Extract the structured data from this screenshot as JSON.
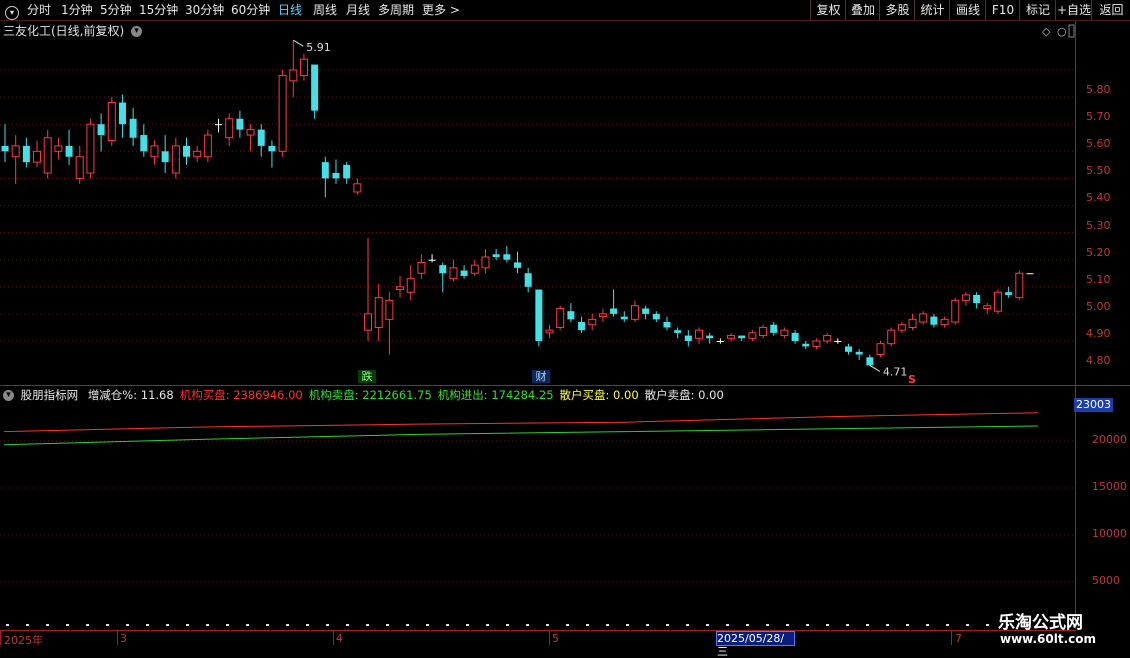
{
  "toolbar": {
    "periods": [
      "分时",
      "1分钟",
      "5分钟",
      "15分钟",
      "30分钟",
      "60分钟",
      "日线",
      "周线",
      "月线",
      "多周期",
      "更多 >"
    ],
    "active_period": "日线",
    "right_buttons": [
      "复权",
      "叠加",
      "多股",
      "统计",
      "画线",
      "F10",
      "标记",
      "+自选",
      "返回"
    ]
  },
  "stock": {
    "title": "三友化工(日线,前复权)"
  },
  "price_axis": [
    "5.80",
    "5.70",
    "5.60",
    "5.50",
    "5.40",
    "5.30",
    "5.20",
    "5.10",
    "5.00",
    "4.90",
    "4.80"
  ],
  "markers": {
    "high": "5.91",
    "low": "4.71",
    "event_a": "跌",
    "event_b": "财",
    "signal": "S"
  },
  "indicator": {
    "name": "股朋指标网",
    "items": [
      {
        "label": "增减仓%: 11.68",
        "color": "#e8e8e8"
      },
      {
        "label": "机构买盘: 2386946.00",
        "color": "#ff3030"
      },
      {
        "label": "机构卖盘: 2212661.75",
        "color": "#30e030"
      },
      {
        "label": "机构进出: 174284.25",
        "color": "#30e030"
      },
      {
        "label": "散户买盘: 0.00",
        "color": "#ffff40"
      },
      {
        "label": "散户卖盘: 0.00",
        "color": "#e8e8e8"
      }
    ],
    "current_value": "23003",
    "axis": [
      "20000",
      "15000",
      "10000",
      "5000"
    ]
  },
  "dates": {
    "year": "2025年",
    "months": [
      "3",
      "4",
      "5",
      "7"
    ],
    "selected": "2025/05/28/三"
  },
  "watermark": {
    "line1": "乐淘公式网",
    "line2": "www.60lt.com"
  },
  "colors": {
    "up": "#ff3b3b",
    "down": "#44e0e8",
    "flat": "#ffffff",
    "buy_line": "#ff3030",
    "sell_line": "#30d030",
    "axis": "#a02020"
  },
  "chart_data": {
    "type": "candlestick",
    "title": "三友化工(日线,前复权)",
    "ylim": [
      4.71,
      5.91
    ],
    "candles": [
      [
        5.52,
        5.5,
        5.6,
        5.46
      ],
      [
        5.48,
        5.52,
        5.56,
        5.38
      ],
      [
        5.52,
        5.46,
        5.55,
        5.44
      ],
      [
        5.46,
        5.5,
        5.54,
        5.44
      ],
      [
        5.42,
        5.55,
        5.58,
        5.4
      ],
      [
        5.5,
        5.52,
        5.55,
        5.47
      ],
      [
        5.52,
        5.48,
        5.58,
        5.45
      ],
      [
        5.4,
        5.48,
        5.52,
        5.38
      ],
      [
        5.42,
        5.6,
        5.62,
        5.4
      ],
      [
        5.6,
        5.56,
        5.64,
        5.5
      ],
      [
        5.54,
        5.68,
        5.7,
        5.52
      ],
      [
        5.68,
        5.6,
        5.71,
        5.55
      ],
      [
        5.62,
        5.55,
        5.66,
        5.52
      ],
      [
        5.56,
        5.5,
        5.6,
        5.48
      ],
      [
        5.48,
        5.52,
        5.54,
        5.45
      ],
      [
        5.5,
        5.46,
        5.56,
        5.42
      ],
      [
        5.42,
        5.52,
        5.55,
        5.4
      ],
      [
        5.52,
        5.48,
        5.55,
        5.45
      ],
      [
        5.48,
        5.5,
        5.52,
        5.46
      ],
      [
        5.48,
        5.56,
        5.58,
        5.46
      ],
      [
        5.6,
        5.6,
        5.62,
        5.57
      ],
      [
        5.55,
        5.62,
        5.64,
        5.52
      ],
      [
        5.62,
        5.58,
        5.65,
        5.55
      ],
      [
        5.56,
        5.58,
        5.6,
        5.5
      ],
      [
        5.58,
        5.52,
        5.6,
        5.48
      ],
      [
        5.52,
        5.5,
        5.54,
        5.44
      ],
      [
        5.5,
        5.78,
        5.8,
        5.48
      ],
      [
        5.76,
        5.8,
        5.91,
        5.7
      ],
      [
        5.78,
        5.84,
        5.86,
        5.76
      ],
      [
        5.82,
        5.65,
        5.82,
        5.62
      ],
      [
        5.46,
        5.4,
        5.48,
        5.33
      ],
      [
        5.42,
        5.4,
        5.47,
        5.38
      ],
      [
        5.45,
        5.4,
        5.46,
        5.38
      ],
      [
        5.35,
        5.38,
        5.4,
        5.34
      ],
      [
        4.84,
        4.9,
        5.18,
        4.8
      ],
      [
        4.85,
        4.96,
        5.01,
        4.8
      ],
      [
        4.88,
        4.95,
        4.98,
        4.75
      ],
      [
        4.99,
        5.0,
        5.04,
        4.96
      ],
      [
        4.98,
        5.03,
        5.08,
        4.95
      ],
      [
        5.05,
        5.09,
        5.12,
        5.03
      ],
      [
        5.1,
        5.1,
        5.12,
        5.09
      ],
      [
        5.08,
        5.05,
        5.09,
        4.98
      ],
      [
        5.03,
        5.07,
        5.1,
        5.02
      ],
      [
        5.06,
        5.04,
        5.08,
        5.03
      ],
      [
        5.05,
        5.08,
        5.1,
        5.04
      ],
      [
        5.07,
        5.11,
        5.14,
        5.05
      ],
      [
        5.12,
        5.11,
        5.14,
        5.1
      ],
      [
        5.12,
        5.1,
        5.15,
        5.09
      ],
      [
        5.09,
        5.07,
        5.13,
        5.05
      ],
      [
        5.05,
        5.0,
        5.07,
        4.98
      ],
      [
        4.99,
        4.8,
        4.99,
        4.78
      ],
      [
        4.83,
        4.84,
        4.86,
        4.81
      ],
      [
        4.85,
        4.92,
        4.93,
        4.84
      ],
      [
        4.91,
        4.88,
        4.94,
        4.87
      ],
      [
        4.87,
        4.84,
        4.89,
        4.83
      ],
      [
        4.86,
        4.88,
        4.9,
        4.84
      ],
      [
        4.89,
        4.9,
        4.92,
        4.87
      ],
      [
        4.92,
        4.9,
        4.99,
        4.89
      ],
      [
        4.89,
        4.88,
        4.91,
        4.87
      ],
      [
        4.88,
        4.93,
        4.95,
        4.87
      ],
      [
        4.92,
        4.9,
        4.93,
        4.88
      ],
      [
        4.9,
        4.88,
        4.91,
        4.87
      ],
      [
        4.87,
        4.85,
        4.89,
        4.84
      ],
      [
        4.84,
        4.83,
        4.85,
        4.81
      ],
      [
        4.82,
        4.8,
        4.84,
        4.78
      ],
      [
        4.81,
        4.84,
        4.85,
        4.79
      ],
      [
        4.82,
        4.81,
        4.83,
        4.79
      ],
      [
        4.8,
        4.8,
        4.81,
        4.79
      ],
      [
        4.81,
        4.82,
        4.83,
        4.8
      ],
      [
        4.82,
        4.81,
        4.82,
        4.8
      ],
      [
        4.81,
        4.83,
        4.84,
        4.8
      ],
      [
        4.82,
        4.85,
        4.86,
        4.81
      ],
      [
        4.86,
        4.83,
        4.87,
        4.82
      ],
      [
        4.82,
        4.84,
        4.85,
        4.81
      ],
      [
        4.83,
        4.8,
        4.84,
        4.79
      ],
      [
        4.79,
        4.78,
        4.8,
        4.77
      ],
      [
        4.78,
        4.8,
        4.81,
        4.77
      ],
      [
        4.8,
        4.82,
        4.83,
        4.79
      ],
      [
        4.8,
        4.8,
        4.81,
        4.79
      ],
      [
        4.78,
        4.76,
        4.79,
        4.75
      ],
      [
        4.76,
        4.75,
        4.77,
        4.73
      ],
      [
        4.74,
        4.71,
        4.75,
        4.71
      ],
      [
        4.75,
        4.79,
        4.8,
        4.74
      ],
      [
        4.79,
        4.84,
        4.85,
        4.78
      ],
      [
        4.84,
        4.86,
        4.87,
        4.83
      ],
      [
        4.85,
        4.88,
        4.9,
        4.84
      ],
      [
        4.87,
        4.9,
        4.91,
        4.86
      ],
      [
        4.89,
        4.86,
        4.9,
        4.85
      ],
      [
        4.86,
        4.88,
        4.89,
        4.85
      ],
      [
        4.87,
        4.95,
        4.96,
        4.86
      ],
      [
        4.95,
        4.97,
        4.98,
        4.93
      ],
      [
        4.97,
        4.94,
        4.98,
        4.92
      ],
      [
        4.92,
        4.93,
        4.94,
        4.9
      ],
      [
        4.91,
        4.98,
        4.99,
        4.9
      ],
      [
        4.98,
        4.97,
        5.0,
        4.96
      ],
      [
        4.96,
        5.05,
        5.06,
        4.95
      ],
      [
        5.05,
        5.05,
        5.05,
        5.05
      ]
    ],
    "series": [
      {
        "name": "机构买盘",
        "values": [
          21000,
          21500,
          21800,
          22000,
          22600,
          23003
        ]
      },
      {
        "name": "机构卖盘",
        "values": [
          19600,
          20200,
          20700,
          21000,
          21300,
          21600
        ]
      }
    ]
  }
}
